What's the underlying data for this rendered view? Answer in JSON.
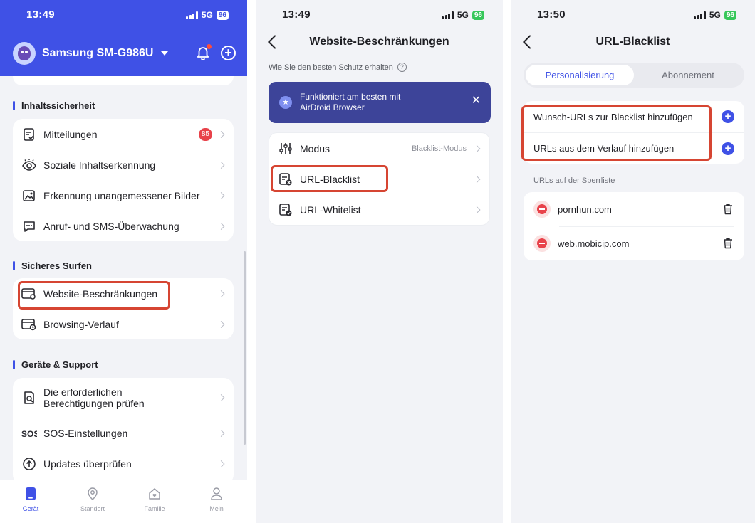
{
  "panel1": {
    "status": {
      "time": "13:49",
      "network": "5G",
      "battery": "96"
    },
    "device_name": "Samsung SM-G986U",
    "sections": [
      {
        "title": "Inhaltssicherheit",
        "items": [
          {
            "label": "Mitteilungen",
            "badge": "85",
            "icon": "message-alert-icon"
          },
          {
            "label": "Soziale Inhaltserkennung",
            "icon": "eye-icon"
          },
          {
            "label": "Erkennung unangemessener Bilder",
            "icon": "image-scan-icon"
          },
          {
            "label": "Anruf- und SMS-Überwachung",
            "icon": "chat-monitor-icon"
          }
        ]
      },
      {
        "title": "Sicheres Surfen",
        "items": [
          {
            "label": "Website-Beschränkungen",
            "icon": "website-settings-icon"
          },
          {
            "label": "Browsing-Verlauf",
            "icon": "browser-history-icon"
          }
        ]
      },
      {
        "title": "Geräte & Support",
        "items": [
          {
            "label": "Die erforderlichen Berechtigungen prüfen",
            "line1": "Die erforderlichen",
            "line2": "Berechtigungen prüfen",
            "icon": "document-search-icon"
          },
          {
            "label": "SOS-Einstellungen",
            "icon": "sos-icon"
          },
          {
            "label": "Updates überprüfen",
            "icon": "arrow-up-circle-icon"
          }
        ]
      }
    ],
    "tabs": [
      {
        "label": "Gerät",
        "active": true
      },
      {
        "label": "Standort"
      },
      {
        "label": "Familie"
      },
      {
        "label": "Mein"
      }
    ]
  },
  "panel2": {
    "status": {
      "time": "13:49",
      "network": "5G",
      "battery": "96"
    },
    "title": "Website-Beschränkungen",
    "hint": "Wie Sie den besten Schutz erhalten",
    "banner": {
      "line1": "Funktioniert am besten mit",
      "line2": "AirDroid Browser"
    },
    "items": [
      {
        "label": "Modus",
        "value": "Blacklist-Modus",
        "icon": "sliders-icon"
      },
      {
        "label": "URL-Blacklist",
        "icon": "blacklist-doc-icon"
      },
      {
        "label": "URL-Whitelist",
        "icon": "whitelist-doc-icon"
      }
    ]
  },
  "panel3": {
    "status": {
      "time": "13:50",
      "network": "5G",
      "battery": "96"
    },
    "title": "URL-Blacklist",
    "segments": {
      "active": "Personalisierung",
      "inactive": "Abonnement"
    },
    "add_actions": [
      "Wunsch-URLs zur Blacklist hinzufügen",
      "URLs aus dem Verlauf hinzufügen"
    ],
    "list_label": "URLs auf der Sperrliste",
    "urls": [
      "pornhun.com",
      "web.mobicip.com"
    ]
  },
  "colors": {
    "accent": "#3f51e6",
    "highlight": "#d64532",
    "badge": "#e8424a",
    "banner": "#3d4499"
  }
}
